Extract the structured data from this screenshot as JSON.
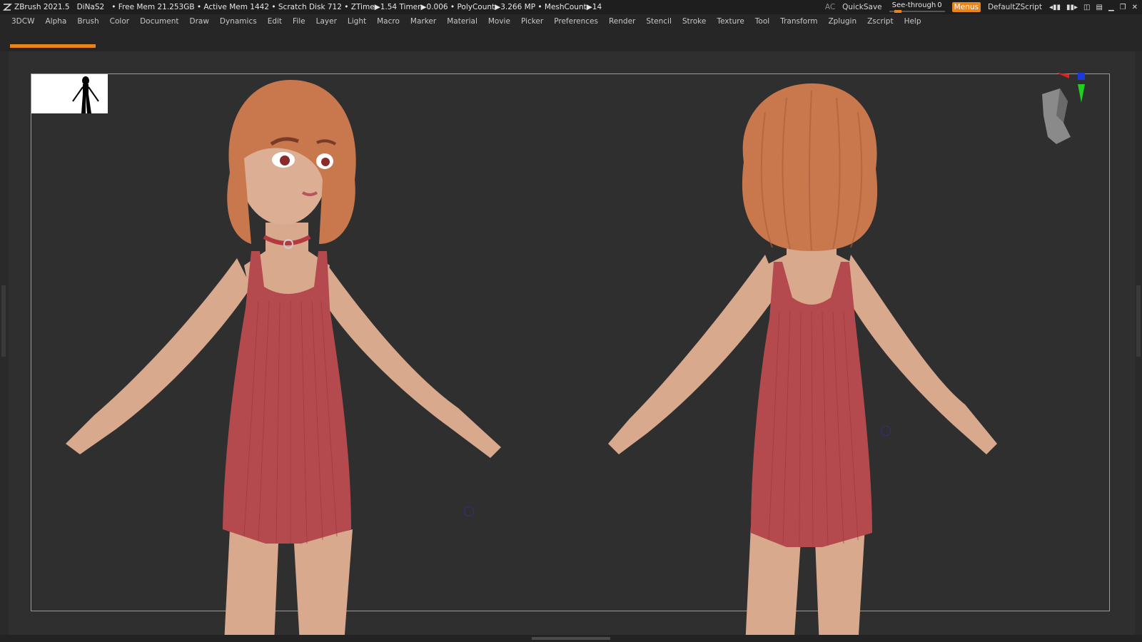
{
  "app": {
    "name": "ZBrush 2021.5",
    "file": "DiNaS2",
    "stats": "• Free Mem 21.253GB • Active Mem 1442 • Scratch Disk 712 •  ZTime▶1.54 Timer▶0.006 • PolyCount▶3.266 MP  • MeshCount▶14"
  },
  "titlebar_right": {
    "ac": "AC",
    "quicksave": "QuickSave",
    "seethrough_label": "See-through",
    "seethrough_value": "0",
    "seethrough_level": 0.1,
    "menus": "Menus",
    "script": "DefaultZScript"
  },
  "menu": [
    "3DCW",
    "Alpha",
    "Brush",
    "Color",
    "Document",
    "Draw",
    "Dynamics",
    "Edit",
    "File",
    "Layer",
    "Light",
    "Macro",
    "Marker",
    "Material",
    "Movie",
    "Picker",
    "Preferences",
    "Render",
    "Stencil",
    "Stroke",
    "Texture",
    "Tool",
    "Transform",
    "Zplugin",
    "Zscript",
    "Help"
  ],
  "icons": {
    "logo": "zbrush-logo-icon",
    "minimize": "minimize-icon",
    "restore": "restore-icon",
    "close": "close-icon"
  },
  "colors": {
    "accent": "#e8841c",
    "background": "#2f2f2f",
    "skin": "#d9a98d",
    "dress": "#b54a4e",
    "hair": "#c9784e"
  }
}
